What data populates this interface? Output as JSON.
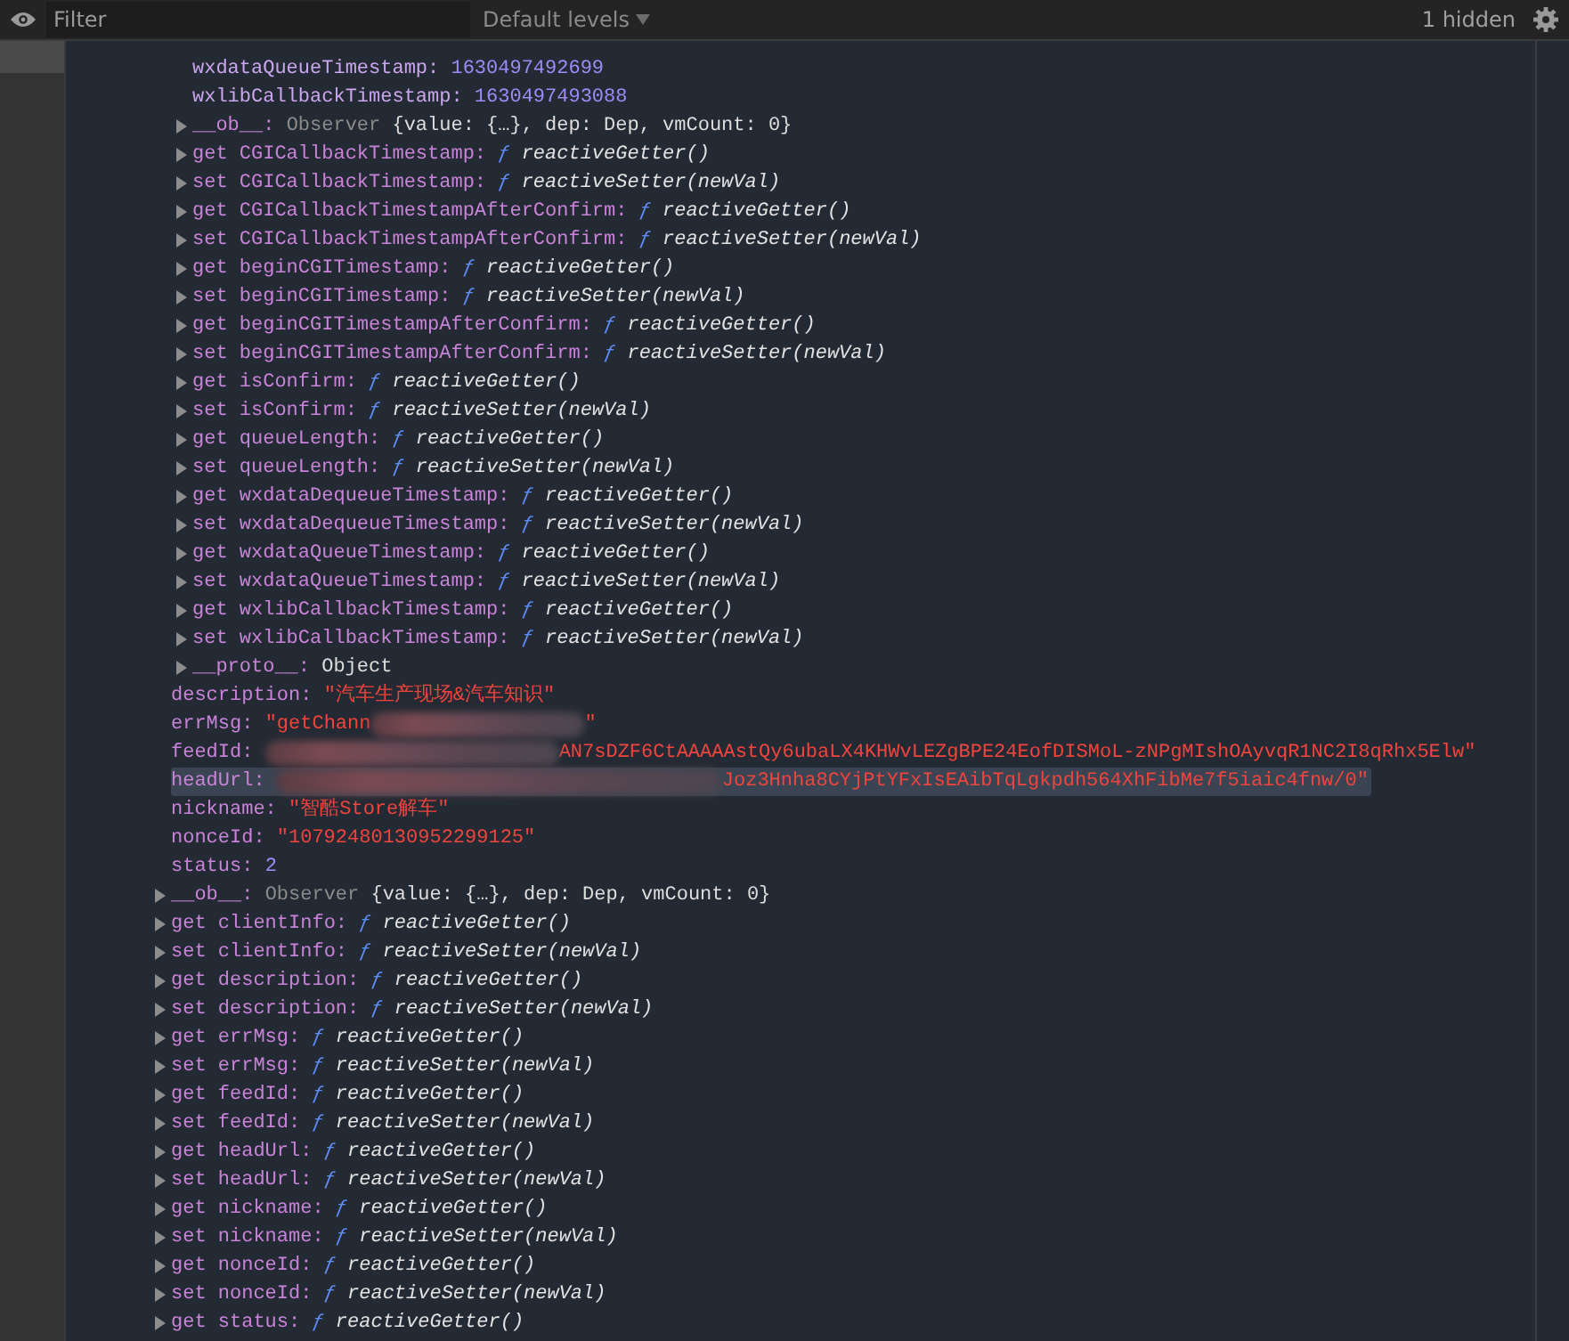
{
  "toolbar": {
    "filter": {
      "placeholder": "Filter"
    },
    "levels": {
      "label": "Default levels"
    },
    "hidden_count": "1 hidden"
  },
  "sidebar": {
    "items": [
      {
        "selected": true
      }
    ]
  },
  "entries": [
    {
      "kind": "group",
      "children": [
        {
          "kind": "prop",
          "key": "wxdataQueueTimestamp:",
          "segments": [
            {
              "kind": "number",
              "text": "1630497492699"
            }
          ],
          "selected": false
        },
        {
          "kind": "prop",
          "key": "wxlibCallbackTimestamp:",
          "segments": [
            {
              "kind": "number",
              "text": "1630497493088"
            }
          ],
          "selected": false
        },
        {
          "kind": "observer",
          "key": "__ob__:",
          "type": "Observer",
          "preview": "{value: {…}, dep: Dep, vmCount: 0}",
          "expanded": false,
          "selected": false
        },
        {
          "kind": "accessor",
          "key": "get CGICallbackTimestamp:",
          "fn": "ƒ",
          "call": "reactiveGetter()",
          "expanded": false,
          "selected": false
        },
        {
          "kind": "accessor",
          "key": "set CGICallbackTimestamp:",
          "fn": "ƒ",
          "call": "reactiveSetter(newVal)",
          "expanded": false,
          "selected": false
        },
        {
          "kind": "accessor",
          "key": "get CGICallbackTimestampAfterConfirm:",
          "fn": "ƒ",
          "call": "reactiveGetter()",
          "expanded": false,
          "selected": false
        },
        {
          "kind": "accessor",
          "key": "set CGICallbackTimestampAfterConfirm:",
          "fn": "ƒ",
          "call": "reactiveSetter(newVal)",
          "expanded": false,
          "selected": false
        },
        {
          "kind": "accessor",
          "key": "get beginCGITimestamp:",
          "fn": "ƒ",
          "call": "reactiveGetter()",
          "expanded": false,
          "selected": false
        },
        {
          "kind": "accessor",
          "key": "set beginCGITimestamp:",
          "fn": "ƒ",
          "call": "reactiveSetter(newVal)",
          "expanded": false,
          "selected": false
        },
        {
          "kind": "accessor",
          "key": "get beginCGITimestampAfterConfirm:",
          "fn": "ƒ",
          "call": "reactiveGetter()",
          "expanded": false,
          "selected": false
        },
        {
          "kind": "accessor",
          "key": "set beginCGITimestampAfterConfirm:",
          "fn": "ƒ",
          "call": "reactiveSetter(newVal)",
          "expanded": false,
          "selected": false
        },
        {
          "kind": "accessor",
          "key": "get isConfirm:",
          "fn": "ƒ",
          "call": "reactiveGetter()",
          "expanded": false,
          "selected": false
        },
        {
          "kind": "accessor",
          "key": "set isConfirm:",
          "fn": "ƒ",
          "call": "reactiveSetter(newVal)",
          "expanded": false,
          "selected": false
        },
        {
          "kind": "accessor",
          "key": "get queueLength:",
          "fn": "ƒ",
          "call": "reactiveGetter()",
          "expanded": false,
          "selected": false
        },
        {
          "kind": "accessor",
          "key": "set queueLength:",
          "fn": "ƒ",
          "call": "reactiveSetter(newVal)",
          "expanded": false,
          "selected": false
        },
        {
          "kind": "accessor",
          "key": "get wxdataDequeueTimestamp:",
          "fn": "ƒ",
          "call": "reactiveGetter()",
          "expanded": false,
          "selected": false
        },
        {
          "kind": "accessor",
          "key": "set wxdataDequeueTimestamp:",
          "fn": "ƒ",
          "call": "reactiveSetter(newVal)",
          "expanded": false,
          "selected": false
        },
        {
          "kind": "accessor",
          "key": "get wxdataQueueTimestamp:",
          "fn": "ƒ",
          "call": "reactiveGetter()",
          "expanded": false,
          "selected": false
        },
        {
          "kind": "accessor",
          "key": "set wxdataQueueTimestamp:",
          "fn": "ƒ",
          "call": "reactiveSetter(newVal)",
          "expanded": false,
          "selected": false
        },
        {
          "kind": "accessor",
          "key": "get wxlibCallbackTimestamp:",
          "fn": "ƒ",
          "call": "reactiveGetter()",
          "expanded": false,
          "selected": false
        },
        {
          "kind": "accessor",
          "key": "set wxlibCallbackTimestamp:",
          "fn": "ƒ",
          "call": "reactiveSetter(newVal)",
          "expanded": false,
          "selected": false
        },
        {
          "kind": "proto",
          "key": "__proto__:",
          "value": "Object",
          "expanded": false,
          "selected": false
        }
      ]
    },
    {
      "kind": "prop",
      "key": "description:",
      "segments": [
        {
          "kind": "string",
          "text": "\"汽车生产现场&汽车知识\""
        }
      ],
      "selected": false
    },
    {
      "kind": "prop",
      "key": "errMsg:",
      "segments": [
        {
          "kind": "string",
          "text": "\"getChann"
        },
        {
          "kind": "blur"
        },
        {
          "kind": "string",
          "text": "\""
        }
      ],
      "selected": false
    },
    {
      "kind": "prop",
      "key": "feedId:",
      "segments": [
        {
          "kind": "blur"
        },
        {
          "kind": "string",
          "text": "AN7sDZF6CtAAAAAstQy6ubaLX4KHWvLEZgBPE24EofDISMoL-zNPgMIshOAyvqR1NC2I8qRhx5Elw\""
        }
      ],
      "selected": false
    },
    {
      "kind": "prop",
      "key": "headUrl:",
      "segments": [
        {
          "kind": "blur"
        },
        {
          "kind": "string",
          "text": "Joz3Hnha8CYjPtYFxIsEAibTqLgkpdh564XhFibMe7f5iaic4fnw/0\""
        }
      ],
      "selected": true
    },
    {
      "kind": "prop",
      "key": "nickname:",
      "segments": [
        {
          "kind": "string",
          "text": "\"智酷Store解车\""
        }
      ],
      "selected": false
    },
    {
      "kind": "prop",
      "key": "nonceId:",
      "segments": [
        {
          "kind": "string",
          "text": "\"10792480130952299125\""
        }
      ],
      "selected": false
    },
    {
      "kind": "prop",
      "key": "status:",
      "segments": [
        {
          "kind": "number",
          "text": "2"
        }
      ],
      "selected": false
    },
    {
      "kind": "observer",
      "key": "__ob__:",
      "type": "Observer",
      "preview": "{value: {…}, dep: Dep, vmCount: 0}",
      "expanded": false,
      "selected": false
    },
    {
      "kind": "accessor",
      "key": "get clientInfo:",
      "fn": "ƒ",
      "call": "reactiveGetter()",
      "expanded": false,
      "selected": false
    },
    {
      "kind": "accessor",
      "key": "set clientInfo:",
      "fn": "ƒ",
      "call": "reactiveSetter(newVal)",
      "expanded": false,
      "selected": false
    },
    {
      "kind": "accessor",
      "key": "get description:",
      "fn": "ƒ",
      "call": "reactiveGetter()",
      "expanded": false,
      "selected": false
    },
    {
      "kind": "accessor",
      "key": "set description:",
      "fn": "ƒ",
      "call": "reactiveSetter(newVal)",
      "expanded": false,
      "selected": false
    },
    {
      "kind": "accessor",
      "key": "get errMsg:",
      "fn": "ƒ",
      "call": "reactiveGetter()",
      "expanded": false,
      "selected": false
    },
    {
      "kind": "accessor",
      "key": "set errMsg:",
      "fn": "ƒ",
      "call": "reactiveSetter(newVal)",
      "expanded": false,
      "selected": false
    },
    {
      "kind": "accessor",
      "key": "get feedId:",
      "fn": "ƒ",
      "call": "reactiveGetter()",
      "expanded": false,
      "selected": false
    },
    {
      "kind": "accessor",
      "key": "set feedId:",
      "fn": "ƒ",
      "call": "reactiveSetter(newVal)",
      "expanded": false,
      "selected": false
    },
    {
      "kind": "accessor",
      "key": "get headUrl:",
      "fn": "ƒ",
      "call": "reactiveGetter()",
      "expanded": false,
      "selected": false
    },
    {
      "kind": "accessor",
      "key": "set headUrl:",
      "fn": "ƒ",
      "call": "reactiveSetter(newVal)",
      "expanded": false,
      "selected": false
    },
    {
      "kind": "accessor",
      "key": "get nickname:",
      "fn": "ƒ",
      "call": "reactiveGetter()",
      "expanded": false,
      "selected": false
    },
    {
      "kind": "accessor",
      "key": "set nickname:",
      "fn": "ƒ",
      "call": "reactiveSetter(newVal)",
      "expanded": false,
      "selected": false
    },
    {
      "kind": "accessor",
      "key": "get nonceId:",
      "fn": "ƒ",
      "call": "reactiveGetter()",
      "expanded": false,
      "selected": false
    },
    {
      "kind": "accessor",
      "key": "set nonceId:",
      "fn": "ƒ",
      "call": "reactiveSetter(newVal)",
      "expanded": false,
      "selected": false
    },
    {
      "kind": "accessor",
      "key": "get status:",
      "fn": "ƒ",
      "call": "reactiveGetter()",
      "expanded": false,
      "selected": false
    }
  ]
}
